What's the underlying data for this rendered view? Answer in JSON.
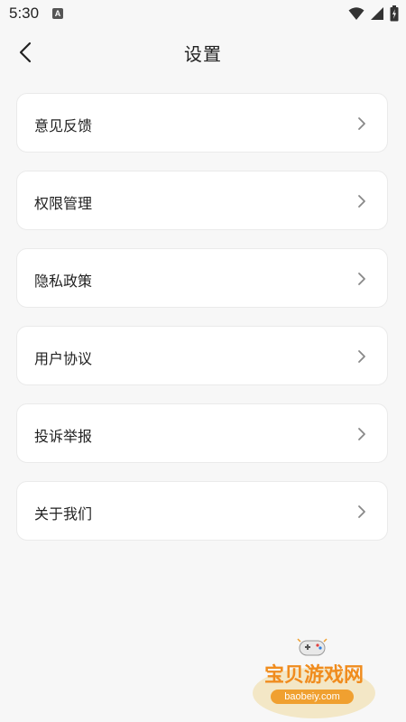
{
  "status_bar": {
    "time": "5:30",
    "notification_badge": "A"
  },
  "header": {
    "title": "设置"
  },
  "menu": {
    "items": [
      {
        "label": "意见反馈"
      },
      {
        "label": "权限管理"
      },
      {
        "label": "隐私政策"
      },
      {
        "label": "用户协议"
      },
      {
        "label": "投诉举报"
      },
      {
        "label": "关于我们"
      }
    ]
  },
  "watermark": {
    "title": "宝贝游戏网",
    "domain": "baobeiy.com"
  },
  "colors": {
    "background": "#f7f7f7",
    "card": "#ffffff",
    "text": "#222222",
    "chevron": "#888888",
    "watermark_orange": "#f08c1e"
  }
}
